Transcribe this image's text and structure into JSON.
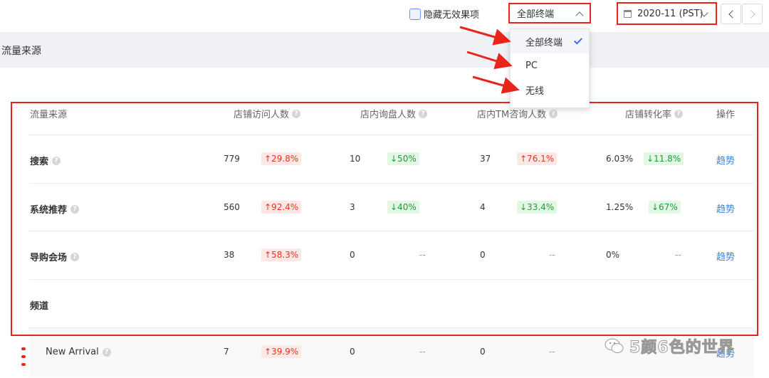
{
  "toolbar": {
    "hide_label": "隐藏无效果项",
    "terminal_value": "全部终端",
    "date_value": "2020-11 (PST)"
  },
  "section": {
    "title": "流量来源"
  },
  "dropdown": {
    "items": [
      {
        "label": "全部终端",
        "selected": true
      },
      {
        "label": "PC",
        "selected": false
      },
      {
        "label": "无线",
        "selected": false
      }
    ]
  },
  "table": {
    "headers": [
      "流量来源",
      "店铺访问人数",
      "店内询盘人数",
      "店内TM咨询人数",
      "店铺转化率",
      "操作"
    ],
    "rows": [
      {
        "name": "搜索",
        "visitors": "779",
        "visitors_chg": "↑29.8%",
        "inquiry": "10",
        "inquiry_chg": "↓50%",
        "tm": "37",
        "tm_chg": "↑76.1%",
        "conv": "6.03%",
        "conv_chg": "↓11.8%",
        "action": "趋势"
      },
      {
        "name": "系统推荐",
        "visitors": "560",
        "visitors_chg": "↑92.4%",
        "inquiry": "3",
        "inquiry_chg": "↓40%",
        "tm": "4",
        "tm_chg": "↓33.4%",
        "conv": "1.25%",
        "conv_chg": "↓67%",
        "action": "趋势"
      },
      {
        "name": "导购会场",
        "visitors": "38",
        "visitors_chg": "↑58.3%",
        "inquiry": "0",
        "inquiry_chg": "--",
        "tm": "0",
        "tm_chg": "--",
        "conv": "0%",
        "conv_chg": "--",
        "action": "趋势"
      },
      {
        "name": "频道"
      },
      {
        "name": "New Arrival",
        "visitors": "7",
        "visitors_chg": "↑39.9%",
        "inquiry": "0",
        "inquiry_chg": "--",
        "tm": "0",
        "tm_chg": "--",
        "action": "趋势"
      }
    ]
  },
  "watermark": {
    "text": "5颜6色的世界"
  },
  "colors": {
    "accent": "#3b82d8",
    "highlight_red": "#e8241b",
    "up_red": "#e8341b",
    "down_green": "#1f9e35"
  }
}
